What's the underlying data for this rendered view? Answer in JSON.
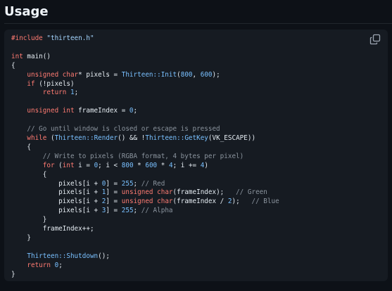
{
  "section": {
    "title": "Usage"
  },
  "copy_button": {
    "icon": "copy-icon",
    "label": "Copy"
  },
  "code_lines": [
    [
      {
        "t": "#include ",
        "c": "kw"
      },
      {
        "t": "\"thirteen.h\"",
        "c": "str"
      }
    ],
    [],
    [
      {
        "t": "int ",
        "c": "kw"
      },
      {
        "t": "main()",
        "c": "pl"
      }
    ],
    [
      {
        "t": "{",
        "c": "pl"
      }
    ],
    [
      {
        "t": "    ",
        "c": "pl"
      },
      {
        "t": "unsigned char",
        "c": "kw"
      },
      {
        "t": "* pixels = ",
        "c": "pl"
      },
      {
        "t": "Thirteen::Init",
        "c": "ns"
      },
      {
        "t": "(",
        "c": "pl"
      },
      {
        "t": "800",
        "c": "num"
      },
      {
        "t": ", ",
        "c": "pl"
      },
      {
        "t": "600",
        "c": "num"
      },
      {
        "t": ");",
        "c": "pl"
      }
    ],
    [
      {
        "t": "    ",
        "c": "pl"
      },
      {
        "t": "if",
        "c": "kw"
      },
      {
        "t": " (!pixels)",
        "c": "pl"
      }
    ],
    [
      {
        "t": "        ",
        "c": "pl"
      },
      {
        "t": "return ",
        "c": "kw"
      },
      {
        "t": "1",
        "c": "num"
      },
      {
        "t": ";",
        "c": "pl"
      }
    ],
    [],
    [
      {
        "t": "    ",
        "c": "pl"
      },
      {
        "t": "unsigned int ",
        "c": "kw"
      },
      {
        "t": "frameIndex = ",
        "c": "pl"
      },
      {
        "t": "0",
        "c": "num"
      },
      {
        "t": ";",
        "c": "pl"
      }
    ],
    [],
    [
      {
        "t": "    ",
        "c": "pl"
      },
      {
        "t": "// Go until window is closed or escape is pressed",
        "c": "cm"
      }
    ],
    [
      {
        "t": "    ",
        "c": "pl"
      },
      {
        "t": "while",
        "c": "kw"
      },
      {
        "t": " (",
        "c": "pl"
      },
      {
        "t": "Thirteen::Render",
        "c": "ns"
      },
      {
        "t": "() && !",
        "c": "pl"
      },
      {
        "t": "Thirteen::GetKey",
        "c": "ns"
      },
      {
        "t": "(VK_ESCAPE))",
        "c": "pl"
      }
    ],
    [
      {
        "t": "    {",
        "c": "pl"
      }
    ],
    [
      {
        "t": "        ",
        "c": "pl"
      },
      {
        "t": "// Write to pixels (RGBA format, 4 bytes per pixel)",
        "c": "cm"
      }
    ],
    [
      {
        "t": "        ",
        "c": "pl"
      },
      {
        "t": "for",
        "c": "kw"
      },
      {
        "t": " (",
        "c": "pl"
      },
      {
        "t": "int ",
        "c": "kw"
      },
      {
        "t": "i = ",
        "c": "pl"
      },
      {
        "t": "0",
        "c": "num"
      },
      {
        "t": "; i < ",
        "c": "pl"
      },
      {
        "t": "800",
        "c": "num"
      },
      {
        "t": " * ",
        "c": "pl"
      },
      {
        "t": "600",
        "c": "num"
      },
      {
        "t": " * ",
        "c": "pl"
      },
      {
        "t": "4",
        "c": "num"
      },
      {
        "t": "; i += ",
        "c": "pl"
      },
      {
        "t": "4",
        "c": "num"
      },
      {
        "t": ")",
        "c": "pl"
      }
    ],
    [
      {
        "t": "        {",
        "c": "pl"
      }
    ],
    [
      {
        "t": "            pixels[i + ",
        "c": "pl"
      },
      {
        "t": "0",
        "c": "num"
      },
      {
        "t": "] = ",
        "c": "pl"
      },
      {
        "t": "255",
        "c": "num"
      },
      {
        "t": "; ",
        "c": "pl"
      },
      {
        "t": "// Red",
        "c": "cm"
      }
    ],
    [
      {
        "t": "            pixels[i + ",
        "c": "pl"
      },
      {
        "t": "1",
        "c": "num"
      },
      {
        "t": "] = ",
        "c": "pl"
      },
      {
        "t": "unsigned ",
        "c": "kw"
      },
      {
        "t": "char",
        "c": "kw"
      },
      {
        "t": "(frameIndex);   ",
        "c": "pl"
      },
      {
        "t": "// Green",
        "c": "cm"
      }
    ],
    [
      {
        "t": "            pixels[i + ",
        "c": "pl"
      },
      {
        "t": "2",
        "c": "num"
      },
      {
        "t": "] = ",
        "c": "pl"
      },
      {
        "t": "unsigned ",
        "c": "kw"
      },
      {
        "t": "char",
        "c": "kw"
      },
      {
        "t": "(frameIndex / ",
        "c": "pl"
      },
      {
        "t": "2",
        "c": "num"
      },
      {
        "t": ");   ",
        "c": "pl"
      },
      {
        "t": "// Blue",
        "c": "cm"
      }
    ],
    [
      {
        "t": "            pixels[i + ",
        "c": "pl"
      },
      {
        "t": "3",
        "c": "num"
      },
      {
        "t": "] = ",
        "c": "pl"
      },
      {
        "t": "255",
        "c": "num"
      },
      {
        "t": "; ",
        "c": "pl"
      },
      {
        "t": "// Alpha",
        "c": "cm"
      }
    ],
    [
      {
        "t": "        }",
        "c": "pl"
      }
    ],
    [
      {
        "t": "        frameIndex++;",
        "c": "pl"
      }
    ],
    [
      {
        "t": "    }",
        "c": "pl"
      }
    ],
    [],
    [
      {
        "t": "    ",
        "c": "pl"
      },
      {
        "t": "Thirteen::Shutdown",
        "c": "ns"
      },
      {
        "t": "();",
        "c": "pl"
      }
    ],
    [
      {
        "t": "    ",
        "c": "pl"
      },
      {
        "t": "return ",
        "c": "kw"
      },
      {
        "t": "0",
        "c": "num"
      },
      {
        "t": ";",
        "c": "pl"
      }
    ],
    [
      {
        "t": "}",
        "c": "pl"
      }
    ]
  ]
}
